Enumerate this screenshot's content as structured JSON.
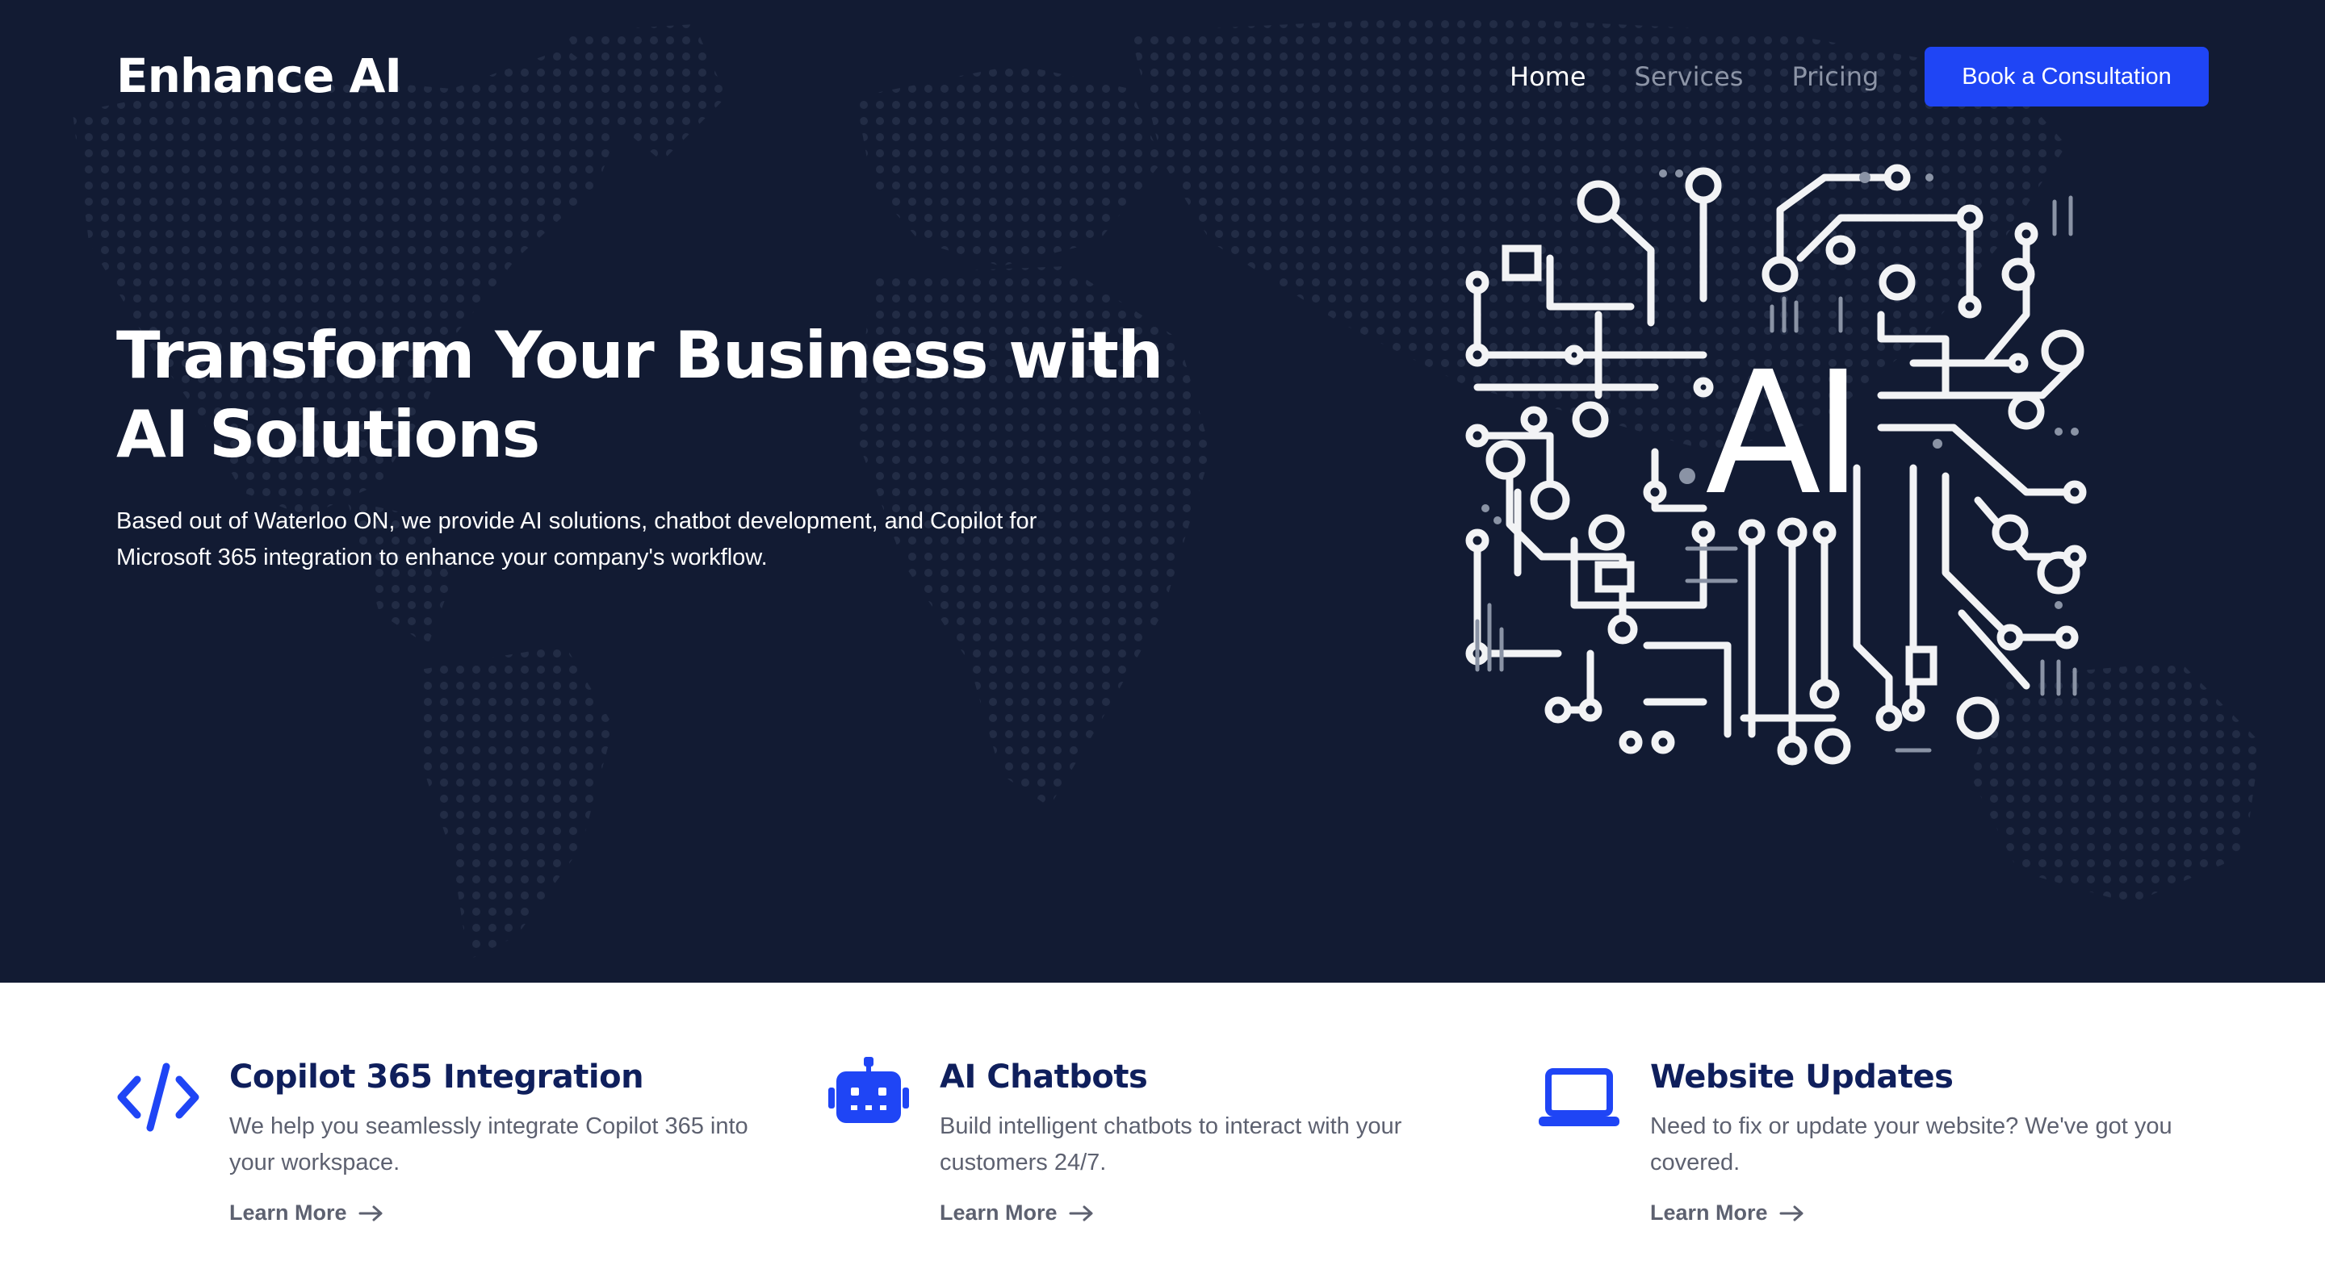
{
  "header": {
    "brand": "Enhance AI",
    "nav": [
      "Home",
      "Services",
      "Pricing"
    ],
    "cta": "Book a Consultation"
  },
  "hero": {
    "title": "Transform Your Business with AI Solutions",
    "subtitle": "Based out of Waterloo ON, we provide AI solutions, chatbot development, and Copilot for Microsoft 365 integration to enhance your company's workflow.",
    "art_label": "AI"
  },
  "features": [
    {
      "icon": "code-icon",
      "title": "Copilot 365 Integration",
      "description": "We help you seamlessly integrate Copilot 365 into your workspace.",
      "link": "Learn More"
    },
    {
      "icon": "robot-icon",
      "title": "AI Chatbots",
      "description": "Build intelligent chatbots to interact with your customers 24/7.",
      "link": "Learn More"
    },
    {
      "icon": "laptop-icon",
      "title": "Website Updates",
      "description": "Need to fix or update your website? We've got you covered.",
      "link": "Learn More"
    }
  ],
  "colors": {
    "hero_bg": "#121b33",
    "accent": "#1f45f5",
    "feature_title": "#0f1f5c",
    "body_text": "#5d6170"
  }
}
